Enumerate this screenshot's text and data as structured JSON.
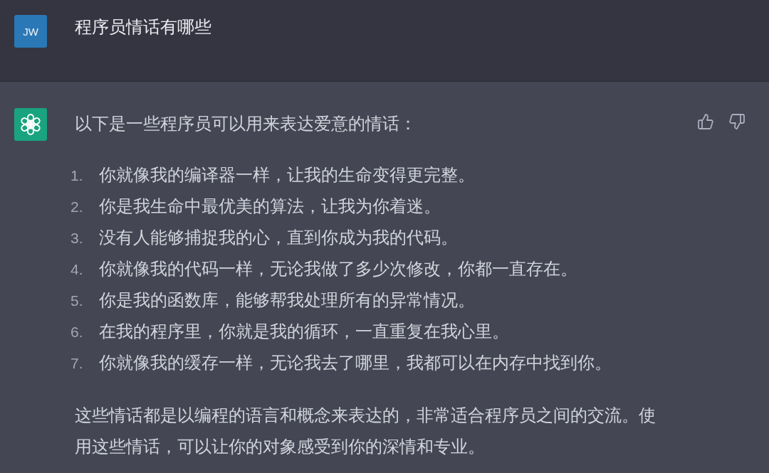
{
  "user_message": {
    "avatar": "JW",
    "text": "程序员情话有哪些"
  },
  "assistant_message": {
    "intro": "以下是一些程序员可以用来表达爱意的情话：",
    "items": [
      {
        "number": "1.",
        "text": "你就像我的编译器一样，让我的生命变得更完整。"
      },
      {
        "number": "2.",
        "text": "你是我生命中最优美的算法，让我为你着迷。"
      },
      {
        "number": "3.",
        "text": "没有人能够捕捉我的心，直到你成为我的代码。"
      },
      {
        "number": "4.",
        "text": "你就像我的代码一样，无论我做了多少次修改，你都一直存在。"
      },
      {
        "number": "5.",
        "text": "你是我的函数库，能够帮我处理所有的异常情况。"
      },
      {
        "number": "6.",
        "text": "在我的程序里，你就是我的循环，一直重复在我心里。"
      },
      {
        "number": "7.",
        "text": "你就像我的缓存一样，无论我去了哪里，我都可以在内存中找到你。"
      }
    ],
    "closing": "这些情话都是以编程的语言和概念来表达的，非常适合程序员之间的交流。使用这些情话，可以让你的对象感受到你的深情和专业。"
  }
}
